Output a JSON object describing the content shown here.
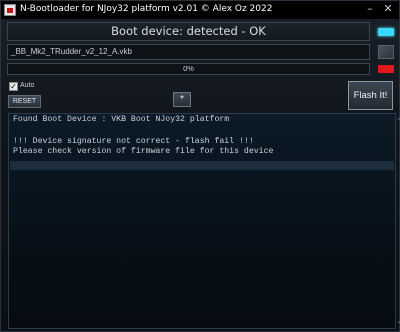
{
  "window": {
    "title": "N-Bootloader for NJoy32 platform v2.01 © Alex Oz 2022",
    "minimize": "–",
    "close": "✕"
  },
  "status": {
    "text": "Boot device: detected - OK",
    "indicator_color": "#38d8ff"
  },
  "file": {
    "path": "_BB_Mk2_TRudder_v2_12_A.vkb"
  },
  "progress": {
    "percent": 0,
    "label": "0%",
    "error_indicator_color": "#e01a1a"
  },
  "controls": {
    "auto_label": "Auto",
    "auto_checked": true,
    "reset_label": "RESET",
    "star_label": "*",
    "flash_label": "Flash It!"
  },
  "log": {
    "lines": [
      "Found Boot Device : VKB Boot NJoy32 platform",
      "",
      "!!! Device signature not correct - flash fail !!!",
      "Please check version of firmware file for this device"
    ]
  }
}
